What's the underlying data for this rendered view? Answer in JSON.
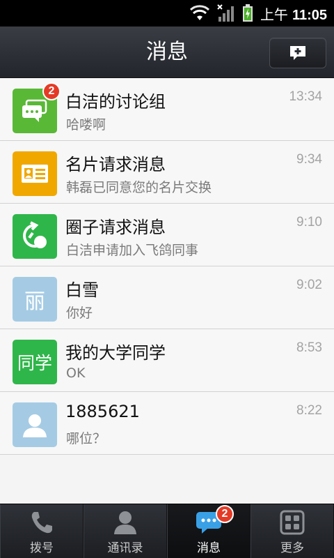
{
  "status_bar": {
    "period": "上午",
    "time": "11:05"
  },
  "header": {
    "title": "消息"
  },
  "messages": [
    {
      "name": "白洁的讨论组",
      "preview": "哈喽啊",
      "time": "13:34",
      "badge": "2",
      "avatar_color": "#5ab837",
      "avatar_icon": "chat-group-icon"
    },
    {
      "name": "名片请求消息",
      "preview": "韩磊已同意您的名片交换",
      "time": "9:34",
      "avatar_color": "#f0a800",
      "avatar_icon": "business-card-icon"
    },
    {
      "name": "圈子请求消息",
      "preview": "白洁申请加入飞鸽同事",
      "time": "9:10",
      "avatar_color": "#2fb64a",
      "avatar_icon": "circle-group-icon"
    },
    {
      "name": "白雪",
      "preview": "你好",
      "time": "9:02",
      "avatar_color": "#a5cbe4",
      "avatar_text": "丽"
    },
    {
      "name": "我的大学同学",
      "preview": "OK",
      "time": "8:53",
      "avatar_color": "#2fb64a",
      "avatar_text": "同学"
    },
    {
      "name": "1885621",
      "preview": "哪位？",
      "time": "8:22",
      "avatar_color": "#a5cbe4",
      "avatar_icon": "person-icon"
    }
  ],
  "nav": {
    "items": [
      {
        "label": "拨号",
        "icon": "phone-icon"
      },
      {
        "label": "通讯录",
        "icon": "contacts-icon"
      },
      {
        "label": "消息",
        "icon": "message-icon",
        "badge": "2",
        "active": true
      },
      {
        "label": "更多",
        "icon": "grid-icon"
      }
    ]
  }
}
